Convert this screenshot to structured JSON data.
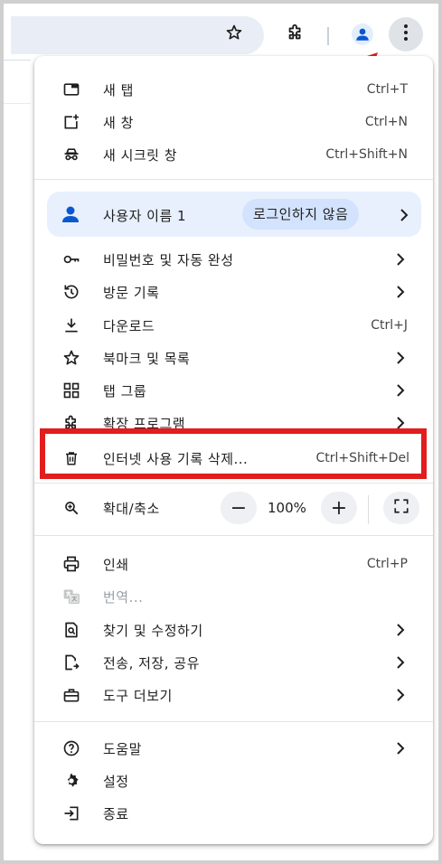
{
  "menu": {
    "section1": [
      {
        "label": "새 탭",
        "shortcut": "Ctrl+T",
        "icon": "new-tab-icon"
      },
      {
        "label": "새 창",
        "shortcut": "Ctrl+N",
        "icon": "new-window-icon"
      },
      {
        "label": "새 시크릿 창",
        "shortcut": "Ctrl+Shift+N",
        "icon": "incognito-icon"
      }
    ],
    "profile": {
      "name": "사용자 이름 1",
      "status": "로그인하지 않음"
    },
    "section2": [
      {
        "label": "비밀번호 및 자동 완성",
        "icon": "key-icon"
      },
      {
        "label": "방문 기록",
        "icon": "history-icon"
      },
      {
        "label": "다운로드",
        "shortcut": "Ctrl+J",
        "icon": "download-icon"
      },
      {
        "label": "북마크 및 목록",
        "icon": "star-icon"
      },
      {
        "label": "탭 그룹",
        "icon": "tab-groups-icon"
      },
      {
        "label": "확장 프로그램",
        "icon": "extension-icon"
      },
      {
        "label": "인터넷 사용 기록 삭제...",
        "shortcut": "Ctrl+Shift+Del",
        "icon": "trash-icon"
      }
    ],
    "zoom": {
      "label": "확대/축소",
      "minus": "−",
      "value": "100%",
      "plus": "+"
    },
    "section3": [
      {
        "label": "인쇄",
        "shortcut": "Ctrl+P",
        "icon": "print-icon"
      },
      {
        "label": "번역...",
        "icon": "translate-icon"
      },
      {
        "label": "찾기 및 수정하기",
        "icon": "find-icon"
      },
      {
        "label": "전송, 저장, 공유",
        "icon": "share-icon"
      },
      {
        "label": "도구 더보기",
        "icon": "toolbox-icon"
      }
    ],
    "section4": [
      {
        "label": "도움말",
        "icon": "help-icon"
      },
      {
        "label": "설정",
        "icon": "settings-icon"
      },
      {
        "label": "종료",
        "icon": "exit-icon"
      }
    ]
  },
  "colors": {
    "highlight": "#e11d1d",
    "accent": "#0b57d0",
    "arrow": "#e11d1d"
  }
}
